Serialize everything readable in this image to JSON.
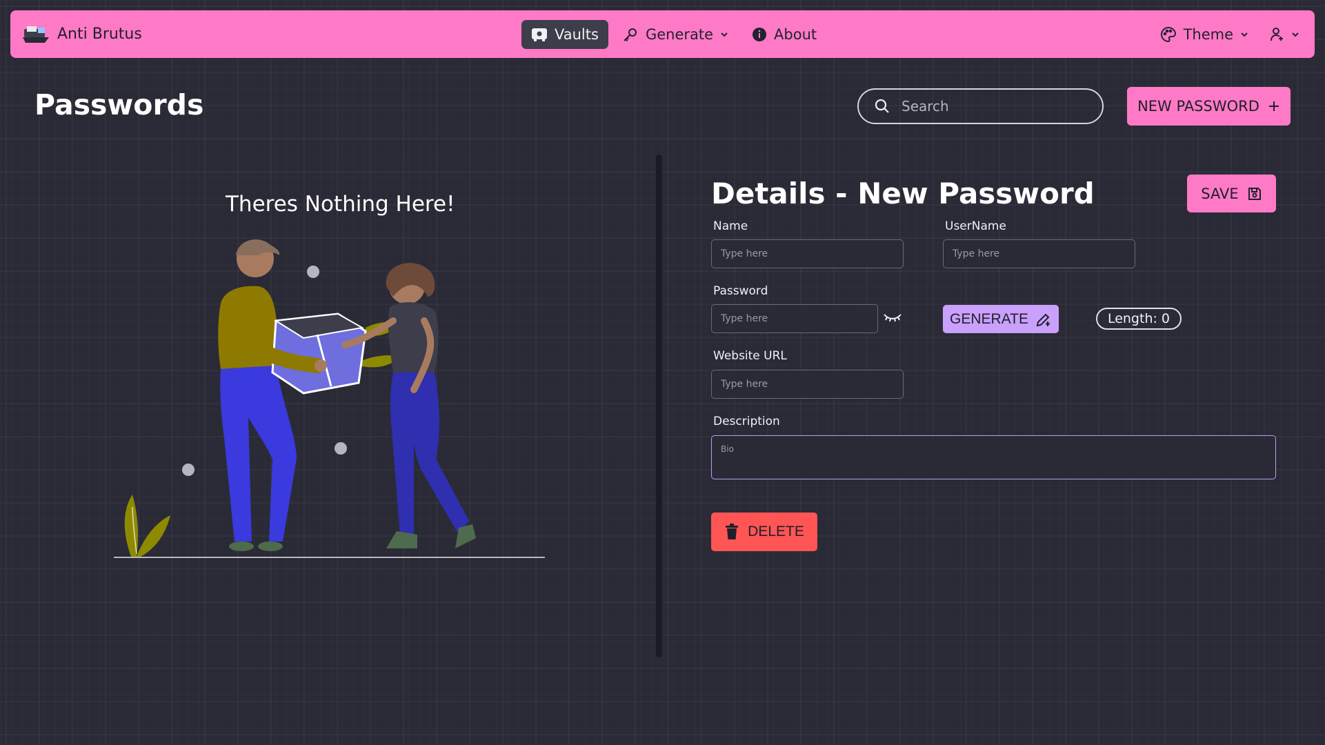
{
  "app": {
    "name": "Anti Brutus",
    "logo_icon": "pirate-ship-icon"
  },
  "nav": {
    "vaults": {
      "label": "Vaults",
      "icon": "vault-icon"
    },
    "generate": {
      "label": "Generate",
      "icon": "key-icon"
    },
    "about": {
      "label": "About",
      "icon": "info-icon"
    },
    "theme": {
      "label": "Theme",
      "icon": "palette-icon"
    },
    "user": {
      "icon": "user-icon"
    }
  },
  "page": {
    "title": "Passwords",
    "search_placeholder": "Search",
    "new_password_label": "NEW PASSWORD"
  },
  "empty_state": {
    "title": "Theres Nothing Here!"
  },
  "details": {
    "title": "Details - New Password",
    "save_label": "SAVE",
    "name_label": "Name",
    "name_placeholder": "Type here",
    "username_label": "UserName",
    "username_placeholder": "Type here",
    "password_label": "Password",
    "password_placeholder": "Type here",
    "generate_label": "GENERATE",
    "length_label": "Length: 0",
    "website_label": "Website URL",
    "website_placeholder": "Type here",
    "description_label": "Description",
    "description_placeholder": "Bio",
    "delete_label": "DELETE"
  },
  "colors": {
    "primary": "#ff7ac6",
    "secondary": "#c9a0fc",
    "danger": "#ff5555",
    "background": "#2a2a36"
  }
}
